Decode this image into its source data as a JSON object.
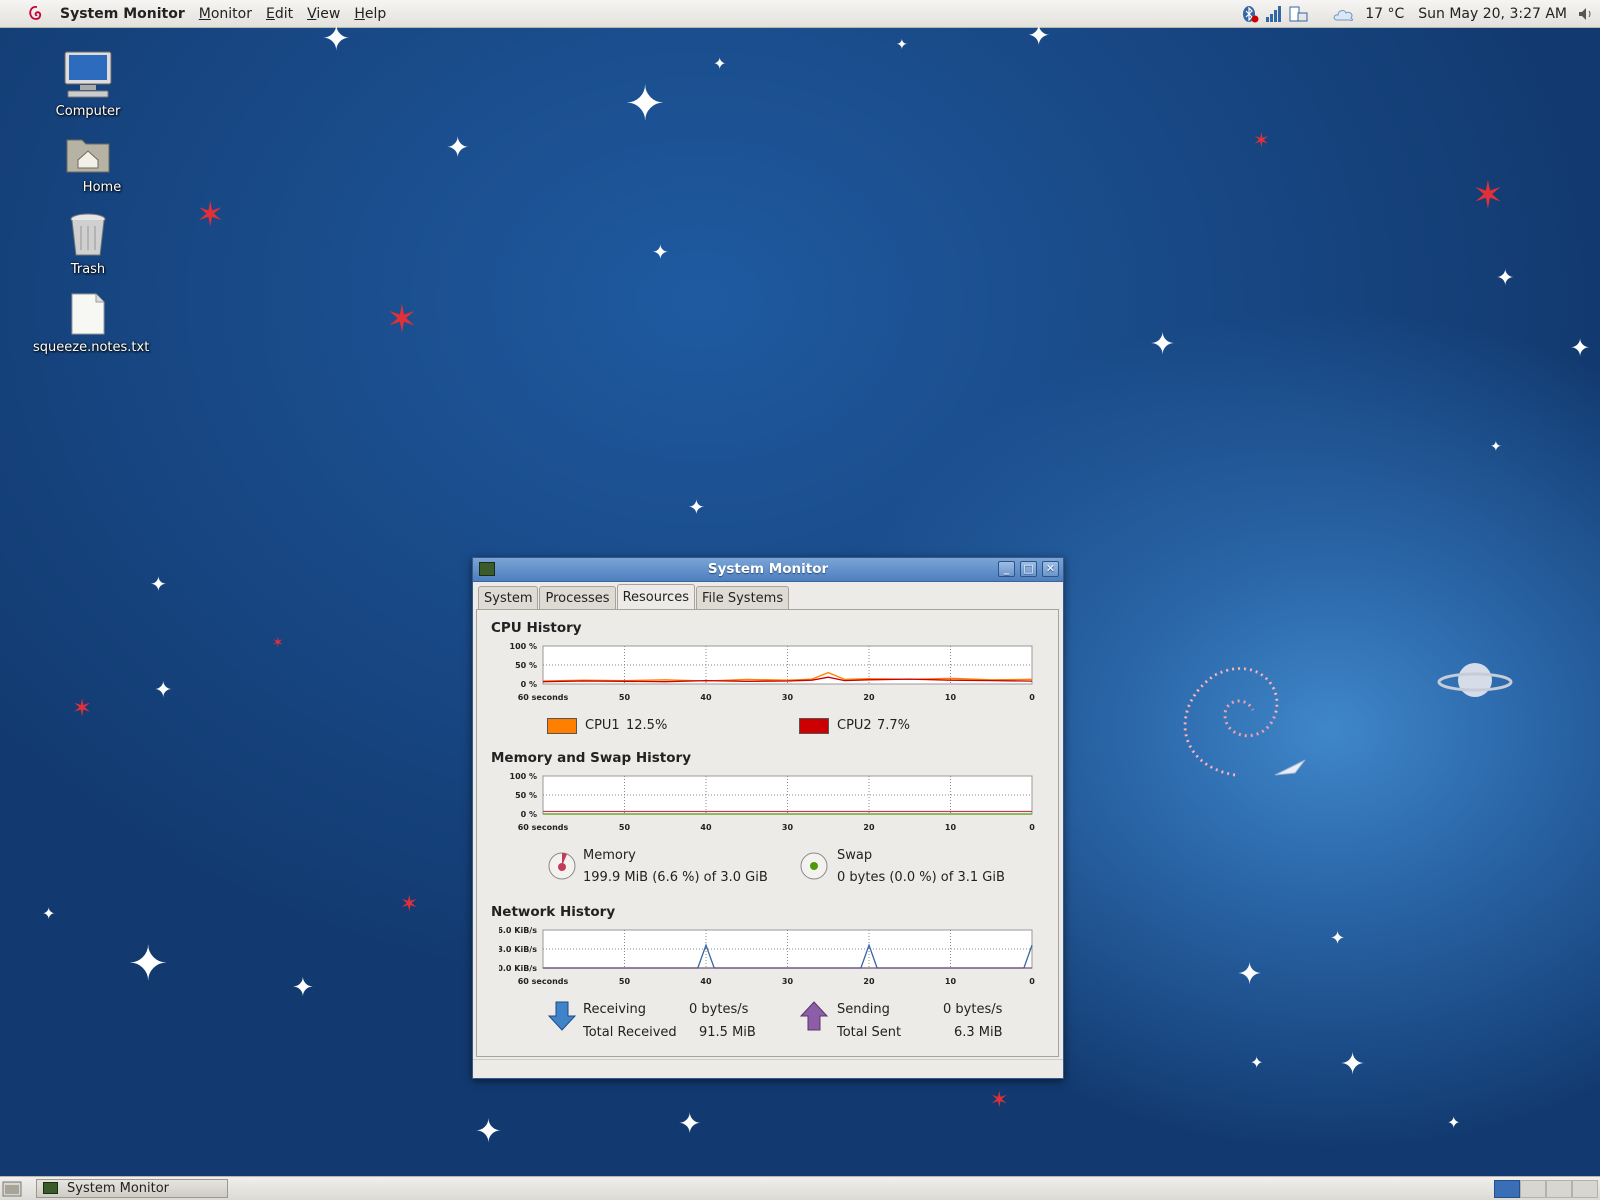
{
  "top_panel": {
    "app_title": "System Monitor",
    "menus": [
      {
        "label": "Monitor",
        "u": "M",
        "rest": "onitor"
      },
      {
        "label": "Edit",
        "u": "E",
        "rest": "dit"
      },
      {
        "label": "View",
        "u": "V",
        "rest": "iew"
      },
      {
        "label": "Help",
        "u": "H",
        "rest": "elp"
      }
    ],
    "tray_icons": [
      "bluetooth-icon",
      "network-signal-icon",
      "battery-icon",
      "weather-cloud-icon",
      "volume-icon"
    ],
    "temperature": "17 °C",
    "clock": "Sun May 20,  3:27 AM"
  },
  "desktop_icons": [
    {
      "label": "Computer",
      "icon": "computer-icon"
    },
    {
      "label": "Home",
      "icon": "home-folder-icon"
    },
    {
      "label": "Trash",
      "icon": "trash-icon"
    },
    {
      "label": "squeeze.notes.txt",
      "icon": "text-file-icon"
    }
  ],
  "window": {
    "title": "System Monitor",
    "tabs": [
      "System",
      "Processes",
      "Resources",
      "File Systems"
    ],
    "active_tab": "Resources",
    "cpu": {
      "title": "CPU History",
      "y_ticks": [
        "100 %",
        "50 %",
        "0 %"
      ],
      "x_ticks": [
        "60 seconds",
        "50",
        "40",
        "30",
        "20",
        "10",
        "0"
      ],
      "cpu1_label": "CPU1",
      "cpu1_value": "12.5%",
      "cpu2_label": "CPU2",
      "cpu2_value": "7.7%",
      "cpu1_color": "#ff7f00",
      "cpu2_color": "#cc0000"
    },
    "memory": {
      "title": "Memory and Swap History",
      "y_ticks": [
        "100 %",
        "50 %",
        "0 %"
      ],
      "x_ticks": [
        "60 seconds",
        "50",
        "40",
        "30",
        "20",
        "10",
        "0"
      ],
      "memory_label": "Memory",
      "memory_value": "199.9 MiB (6.6 %) of 3.0 GiB",
      "swap_label": "Swap",
      "swap_value": "0 bytes (0.0 %) of 3.1 GiB",
      "memory_color": "#c23c5a",
      "swap_color": "#4e9a06"
    },
    "network": {
      "title": "Network History",
      "y_ticks": [
        "6.0 KiB/s",
        "3.0 KiB/s",
        "0.0 KiB/s"
      ],
      "x_ticks": [
        "60 seconds",
        "50",
        "40",
        "30",
        "20",
        "10",
        "0"
      ],
      "receiving_label": "Receiving",
      "receiving_value": "0 bytes/s",
      "total_received_label": "Total Received",
      "total_received_value": "91.5 MiB",
      "sending_label": "Sending",
      "sending_value": "0 bytes/s",
      "total_sent_label": "Total Sent",
      "total_sent_value": "6.3 MiB",
      "receiving_color": "#3465a4",
      "sending_color": "#75507b"
    }
  },
  "bottom_panel": {
    "taskbar_item": "System Monitor"
  },
  "chart_data": [
    {
      "type": "line",
      "title": "CPU History",
      "x": [
        60,
        55,
        50,
        45,
        40,
        35,
        30,
        27,
        25,
        23,
        20,
        15,
        10,
        5,
        0
      ],
      "ylim": [
        0,
        100
      ],
      "series": [
        {
          "name": "CPU1",
          "values": [
            8,
            10,
            9,
            11,
            8,
            12,
            10,
            13,
            30,
            12,
            14,
            12,
            15,
            11,
            12.5
          ]
        },
        {
          "name": "CPU2",
          "values": [
            6,
            8,
            7,
            6,
            9,
            7,
            8,
            10,
            18,
            9,
            11,
            13,
            10,
            9,
            7.7
          ]
        }
      ],
      "x_tick_labels": [
        "60 seconds",
        "50",
        "40",
        "30",
        "20",
        "10",
        "0"
      ],
      "y_tick_labels": [
        "100 %",
        "50 %",
        "0 %"
      ]
    },
    {
      "type": "line",
      "title": "Memory and Swap History",
      "x": [
        60,
        0
      ],
      "ylim": [
        0,
        100
      ],
      "series": [
        {
          "name": "Memory",
          "values": [
            6.6,
            6.6
          ]
        },
        {
          "name": "Swap",
          "values": [
            0,
            0
          ]
        }
      ]
    },
    {
      "type": "line",
      "title": "Network History",
      "x": [
        60,
        41,
        40,
        39,
        21,
        20,
        19,
        1,
        0
      ],
      "ylim": [
        0,
        6
      ],
      "series": [
        {
          "name": "Receiving",
          "values": [
            0,
            0,
            3.6,
            0,
            0,
            3.6,
            0,
            0,
            3.6
          ]
        },
        {
          "name": "Sending",
          "values": [
            0,
            0,
            0,
            0,
            0,
            0,
            0,
            0,
            0
          ]
        }
      ]
    }
  ]
}
